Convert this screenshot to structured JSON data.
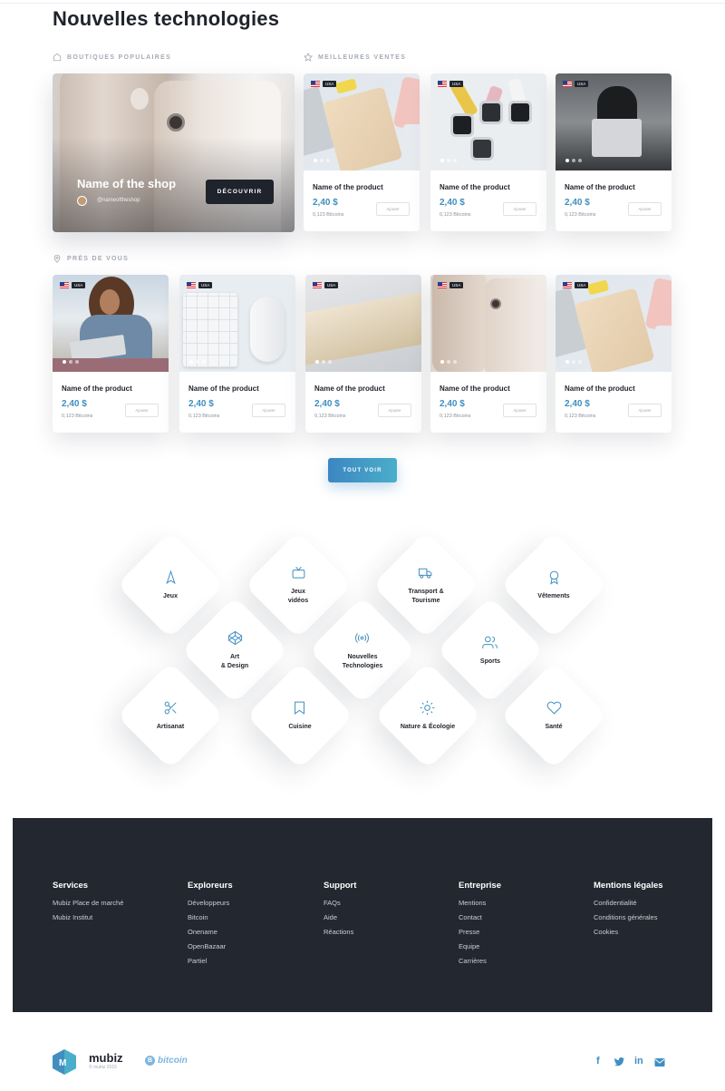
{
  "page": {
    "title": "Nouvelles technologies"
  },
  "sections": {
    "popular_shops": "BOUTIQUES POPULAIRES",
    "best_sellers": "MEILLEURES VENTES",
    "near_you": "PRÈS DE VOUS"
  },
  "shop": {
    "name": "Name of the shop",
    "handle": "@nameoftheshop",
    "button": "DÉCOUVRIR"
  },
  "best_sellers": [
    {
      "country": "USA",
      "name": "Name of the product",
      "price": "2,40 $",
      "btc": "0,123 Bitcoins",
      "add": "Ajouter",
      "image": "ipad-watch"
    },
    {
      "country": "USA",
      "name": "Name of the product",
      "price": "2,40 $",
      "btc": "0,123 Bitcoins",
      "add": "Ajouter",
      "image": "watches"
    },
    {
      "country": "USA",
      "name": "Name of the product",
      "price": "2,40 $",
      "btc": "0,123 Bitcoins",
      "add": "Ajouter",
      "image": "dark-laptop"
    }
  ],
  "near_you": [
    {
      "country": "USA",
      "name": "Name of the product",
      "price": "2,40 $",
      "btc": "0,123 Bitcoins",
      "add": "Ajouter",
      "image": "woman-laptop"
    },
    {
      "country": "USA",
      "name": "Name of the product",
      "price": "2,40 $",
      "btc": "0,123 Bitcoins",
      "add": "Ajouter",
      "image": "keyboard-mouse"
    },
    {
      "country": "USA",
      "name": "Name of the product",
      "price": "2,40 $",
      "btc": "0,123 Bitcoins",
      "add": "Ajouter",
      "image": "macbook"
    },
    {
      "country": "USA",
      "name": "Name of the product",
      "price": "2,40 $",
      "btc": "0,123 Bitcoins",
      "add": "Ajouter",
      "image": "iphones"
    },
    {
      "country": "USA",
      "name": "Name of the product",
      "price": "2,40 $",
      "btc": "0,123 Bitcoins",
      "add": "Ajouter",
      "image": "ipad-watch"
    }
  ],
  "see_all": "TOUT VOIR",
  "categories": [
    {
      "label": "Jeux",
      "icon": "navigation-icon"
    },
    {
      "label": "Jeux\nvidéos",
      "icon": "tv-icon"
    },
    {
      "label": "Transport &\nTourisme",
      "icon": "truck-icon"
    },
    {
      "label": "Vêtements",
      "icon": "award-icon"
    },
    {
      "label": "Art\n& Design",
      "icon": "codepen-icon"
    },
    {
      "label": "Nouvelles\nTechnologies",
      "icon": "radio-icon"
    },
    {
      "label": "Sports",
      "icon": "users-icon"
    },
    {
      "label": "Artisanat",
      "icon": "scissors-icon"
    },
    {
      "label": "Cuisine",
      "icon": "bookmark-icon"
    },
    {
      "label": "Nature & Écologie",
      "icon": "sun-icon"
    },
    {
      "label": "Santé",
      "icon": "heart-icon"
    }
  ],
  "footer": {
    "columns": [
      {
        "title": "Services",
        "links": [
          "Mubiz Place de marché",
          "Mubiz Institut"
        ]
      },
      {
        "title": "Exploreurs",
        "links": [
          "Développeurs",
          "Bitcoin",
          "Onename",
          "OpenBazaar",
          "Partiel"
        ]
      },
      {
        "title": "Support",
        "links": [
          "FAQs",
          "Aide",
          "Réactions"
        ]
      },
      {
        "title": "Entreprise",
        "links": [
          "Mentions",
          "Contact",
          "Presse",
          "Equipe",
          "Carrières"
        ]
      },
      {
        "title": "Mentions légales",
        "links": [
          "Confidentialité",
          "Conditions générales",
          "Cookies"
        ]
      }
    ]
  },
  "bottom": {
    "brand": "mubiz",
    "copyright": "© mubiz 2015",
    "partner": "bitcoin",
    "social": [
      "facebook-icon",
      "twitter-icon",
      "linkedin-icon",
      "mail-icon"
    ]
  },
  "colors": {
    "accent": "#3f8fc0",
    "dark": "#1f232b",
    "footer": "#232830"
  }
}
